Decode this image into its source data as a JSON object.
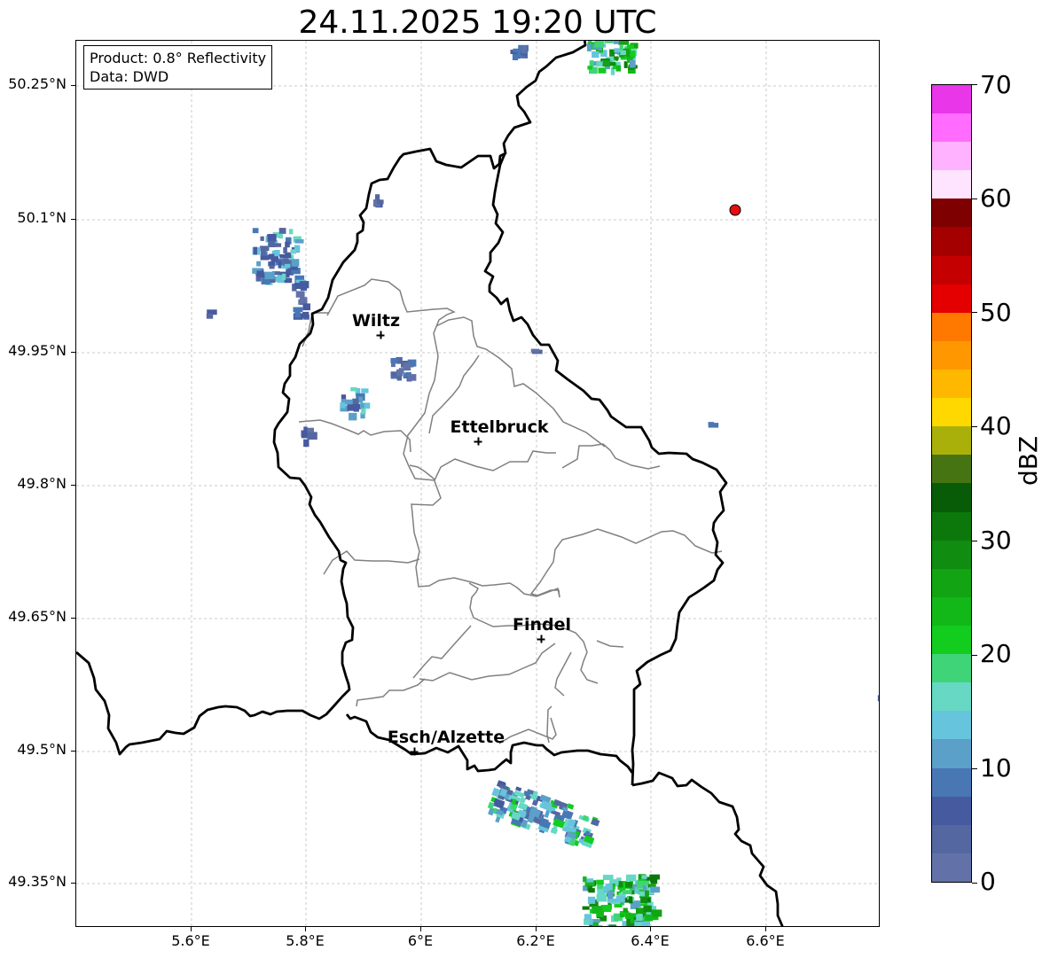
{
  "title": "24.11.2025 19:20 UTC",
  "info_box": {
    "product": "Product: 0.8° Reflectivity",
    "source": "Data: DWD"
  },
  "lat_labels": [
    "50.25°N",
    "50.1°N",
    "49.95°N",
    "49.8°N",
    "49.65°N",
    "49.5°N",
    "49.35°N"
  ],
  "lon_labels": [
    "5.6°E",
    "5.8°E",
    "6°E",
    "6.2°E",
    "6.4°E",
    "6.6°E"
  ],
  "cities": [
    {
      "name": "Wiltz",
      "lon": 5.93,
      "lat": 49.967
    },
    {
      "name": "Ettelbruck",
      "lon": 6.1,
      "lat": 49.847
    },
    {
      "name": "Findel",
      "lon": 6.21,
      "lat": 49.624
    },
    {
      "name": "Esch/Alzette",
      "lon": 5.99,
      "lat": 49.497
    }
  ],
  "station": {
    "lon": 6.547,
    "lat": 50.11,
    "color": "#e41010"
  },
  "colorbar": {
    "unit": "dBZ",
    "tick_labels": [
      "0",
      "10",
      "20",
      "30",
      "40",
      "50",
      "60",
      "70"
    ],
    "min": 0,
    "max": 70,
    "step": 2.5,
    "colors": [
      "#6272a8",
      "#5567a0",
      "#465aa0",
      "#4877b4",
      "#5ba0c8",
      "#66c4dc",
      "#66d8c4",
      "#40d478",
      "#12cc1e",
      "#12b818",
      "#12a412",
      "#108c10",
      "#0c780c",
      "#085c08",
      "#467412",
      "#aab00a",
      "#ffd800",
      "#ffb800",
      "#ff9800",
      "#ff7800",
      "#e40000",
      "#c40000",
      "#a40000",
      "#7e0000",
      "#ffe4ff",
      "#ffb2ff",
      "#ff6cff",
      "#e836e8"
    ]
  },
  "map_colors": {
    "border": "#000000",
    "cantons": "#808080",
    "grid": "#bbbbbb"
  }
}
